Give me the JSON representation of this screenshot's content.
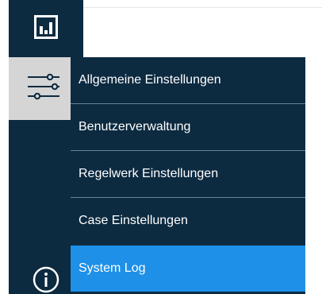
{
  "sidebar": {
    "items": [
      {
        "name": "dashboard",
        "icon": "bar-chart-icon"
      },
      {
        "name": "settings",
        "icon": "sliders-icon",
        "active": true
      },
      {
        "name": "info",
        "icon": "info-icon"
      }
    ]
  },
  "settings_menu": {
    "items": [
      {
        "label": "Allgemeine Einstellungen"
      },
      {
        "label": "Benutzerverwaltung"
      },
      {
        "label": "Regelwerk Einstellungen"
      },
      {
        "label": "Case Einstellungen"
      },
      {
        "label": "System Log",
        "selected": true
      }
    ]
  },
  "colors": {
    "sidebar_bg": "#0c2a40",
    "active_item_bg": "#d5d5d5",
    "selected_bg": "#1e90e8",
    "text": "#ffffff",
    "separator": "#6a8296"
  }
}
